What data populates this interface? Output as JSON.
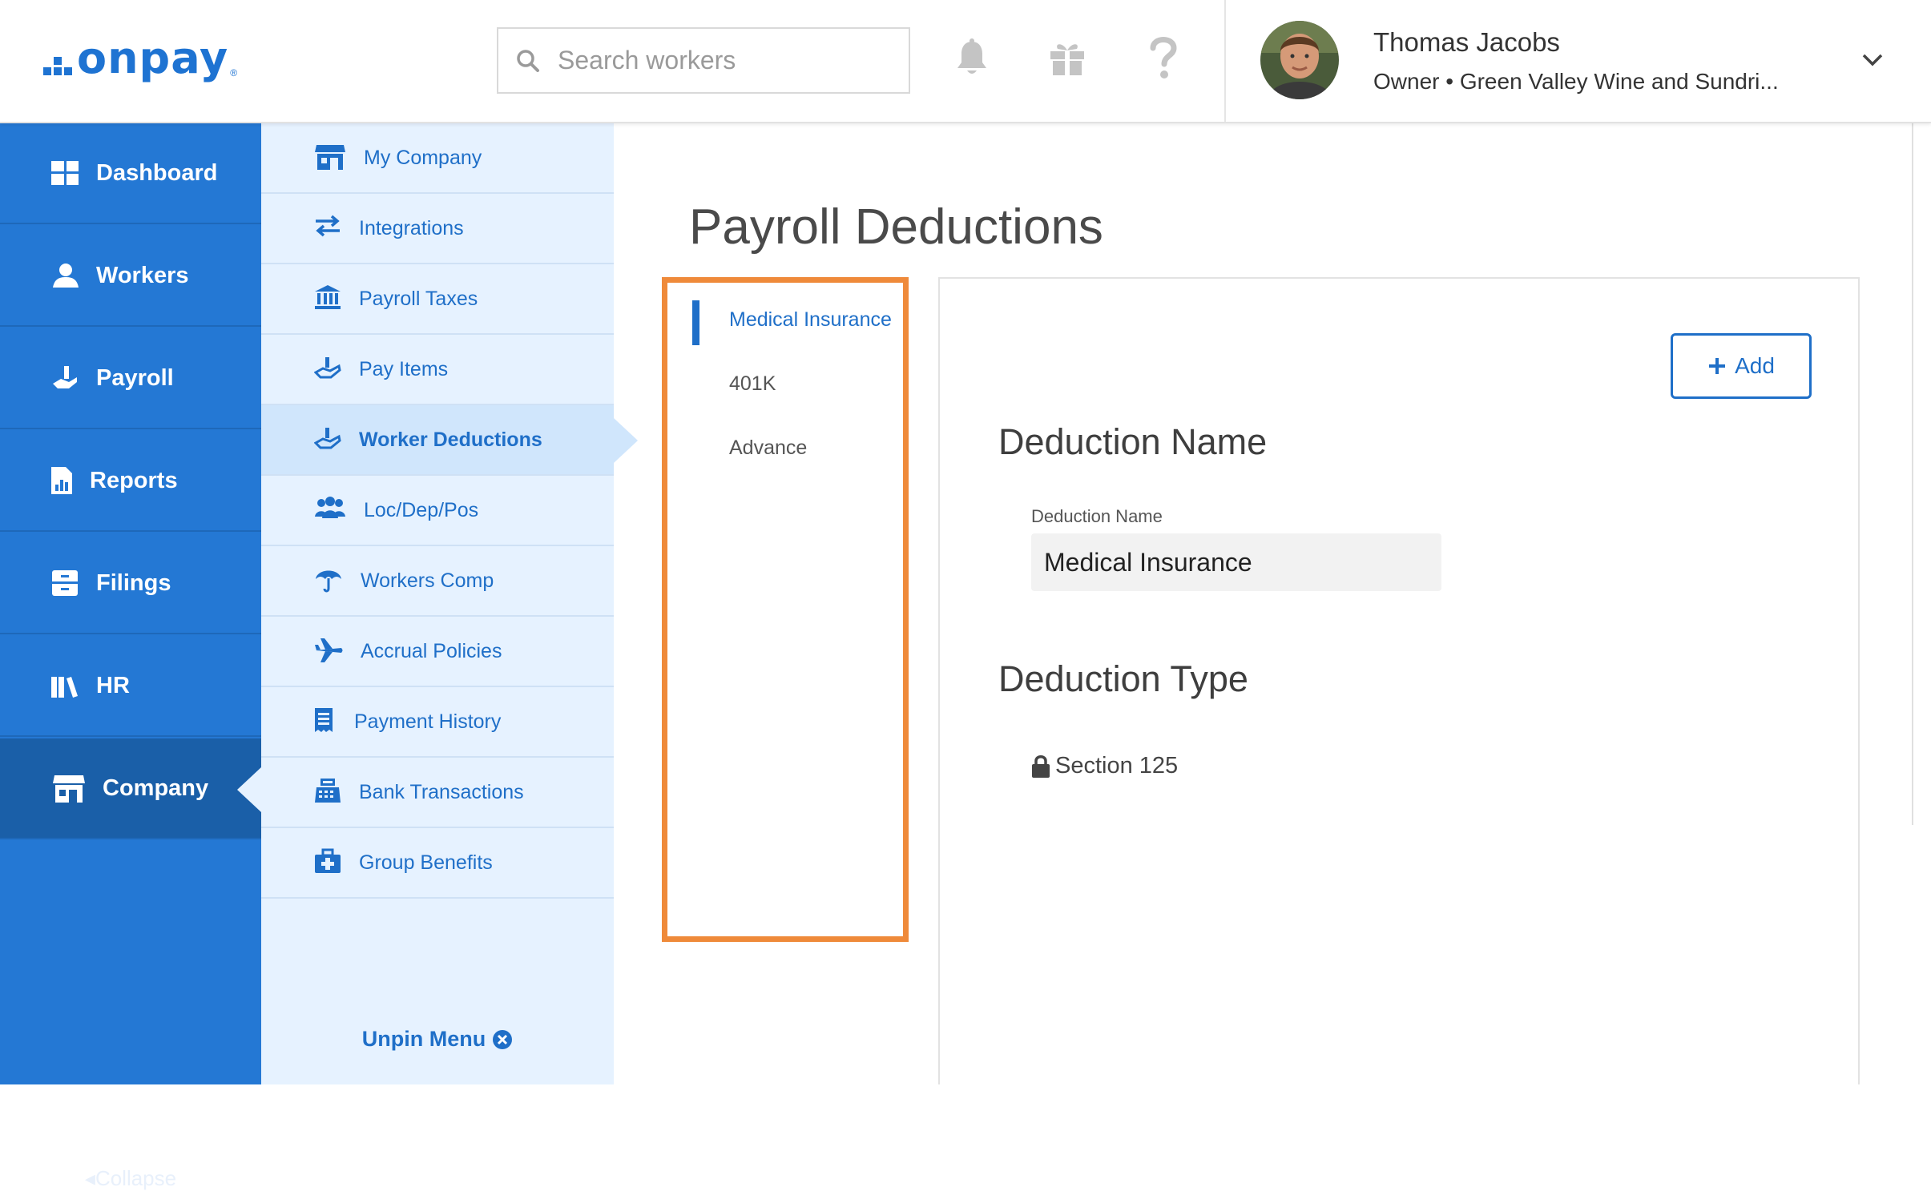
{
  "header": {
    "logo_text": "onpay",
    "logo_mark": "®",
    "search_placeholder": "Search workers",
    "icons": [
      "bell-icon",
      "gift-icon",
      "help-icon"
    ],
    "user": {
      "name": "Thomas Jacobs",
      "role": "Owner • Green Valley Wine and Sundri..."
    }
  },
  "leftnav": {
    "items": [
      {
        "label": "Dashboard",
        "icon": "dashboard-icon"
      },
      {
        "label": "Workers",
        "icon": "workers-icon"
      },
      {
        "label": "Payroll",
        "icon": "payroll-icon"
      },
      {
        "label": "Reports",
        "icon": "reports-icon"
      },
      {
        "label": "Filings",
        "icon": "filings-icon"
      },
      {
        "label": "HR",
        "icon": "hr-icon"
      },
      {
        "label": "Company",
        "icon": "company-icon",
        "active": true
      }
    ],
    "collapse_label": "Collapse"
  },
  "subnav": {
    "items": [
      {
        "label": "My Company",
        "icon": "store-icon"
      },
      {
        "label": "Integrations",
        "icon": "arrows-icon"
      },
      {
        "label": "Payroll Taxes",
        "icon": "bank-icon"
      },
      {
        "label": "Pay Items",
        "icon": "hand-icon"
      },
      {
        "label": "Worker Deductions",
        "icon": "hand-icon",
        "active": true
      },
      {
        "label": "Loc/Dep/Pos",
        "icon": "people-icon"
      },
      {
        "label": "Workers Comp",
        "icon": "umbrella-icon"
      },
      {
        "label": "Accrual Policies",
        "icon": "plane-icon"
      },
      {
        "label": "Payment History",
        "icon": "receipt-icon"
      },
      {
        "label": "Bank Transactions",
        "icon": "register-icon"
      },
      {
        "label": "Group Benefits",
        "icon": "medkit-icon"
      }
    ],
    "unpin_label": "Unpin Menu"
  },
  "main": {
    "title": "Payroll Deductions",
    "deductions": [
      {
        "label": "Medical Insurance",
        "active": true
      },
      {
        "label": "401K"
      },
      {
        "label": "Advance"
      }
    ],
    "add_label": "Add",
    "name_heading": "Deduction Name",
    "name_field_label": "Deduction Name",
    "name_field_value": "Medical Insurance",
    "type_heading": "Deduction Type",
    "type_value": "Section 125"
  },
  "colors": {
    "brand_blue": "#2478d4",
    "highlight_orange": "#ef8a3a",
    "link_blue": "#1f6fc8"
  }
}
